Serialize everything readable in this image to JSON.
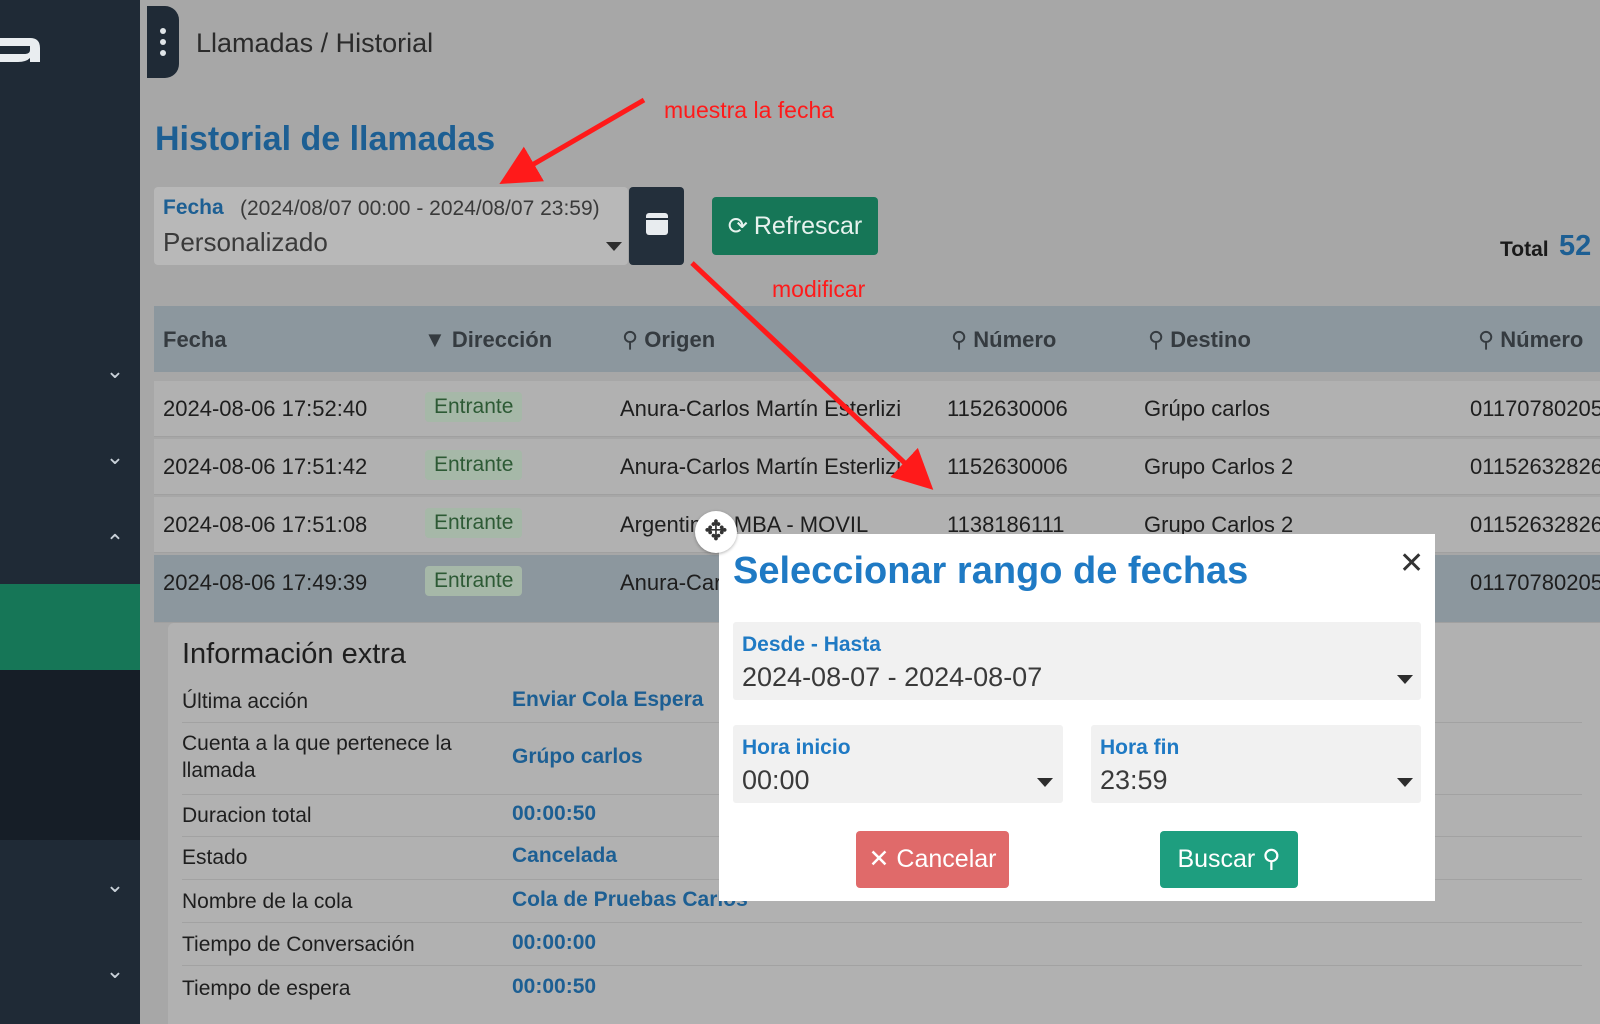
{
  "breadcrumb": "Llamadas / Historial",
  "page_title": "Historial de llamadas",
  "date_filter": {
    "label": "Fecha",
    "range": "(2024/08/07 00:00 - 2024/08/07 23:59)",
    "value": "Personalizado"
  },
  "refresh_label": "Refrescar",
  "total": {
    "label": "Total",
    "value": "52"
  },
  "table": {
    "headers": [
      "Fecha",
      "Dirección",
      "Origen",
      "Número",
      "Destino",
      "Número"
    ],
    "rows": [
      {
        "fecha": "2024-08-06 17:52:40",
        "direccion": "Entrante",
        "origen": "Anura-Carlos Martín Esterlizi",
        "numero": "1152630006",
        "destino": "Grúpo carlos",
        "numero2": "01170780205"
      },
      {
        "fecha": "2024-08-06 17:51:42",
        "direccion": "Entrante",
        "origen": "Anura-Carlos Martín Esterlizi",
        "numero": "1152630006",
        "destino": "Grupo Carlos 2",
        "numero2": "01152632826"
      },
      {
        "fecha": "2024-08-06 17:51:08",
        "direccion": "Entrante",
        "origen": "Argentina AMBA - MOVIL",
        "numero": "1138186111",
        "destino": "Grupo Carlos 2",
        "numero2": "01152632826"
      },
      {
        "fecha": "2024-08-06 17:49:39",
        "direccion": "Entrante",
        "origen": "Anura-Carlos Martín Esterlizi",
        "numero": "",
        "destino": "",
        "numero2": "01170780205"
      }
    ]
  },
  "extra_info": {
    "title": "Información extra",
    "items": [
      {
        "key": "Última acción",
        "value": "Enviar Cola Espera"
      },
      {
        "key": "Cuenta a la que pertenece la llamada",
        "value": "Grúpo carlos"
      },
      {
        "key": "Duracion total",
        "value": "00:00:50"
      },
      {
        "key": "Estado",
        "value": "Cancelada"
      },
      {
        "key": "Nombre de la cola",
        "value": "Cola de Pruebas Carlos"
      },
      {
        "key": "Tiempo de Conversación",
        "value": "00:00:00"
      },
      {
        "key": "Tiempo de espera",
        "value": "00:00:50"
      }
    ]
  },
  "modal": {
    "title": "Seleccionar rango de fechas",
    "range_label": "Desde - Hasta",
    "range_value": "2024-08-07 - 2024-08-07",
    "start_label": "Hora inicio",
    "start_value": "00:00",
    "end_label": "Hora fin",
    "end_value": "23:59",
    "cancel_label": "Cancelar",
    "search_label": "Buscar"
  },
  "annotations": {
    "show_date": "muestra la fecha",
    "modify": "modificar"
  },
  "colors": {
    "accent": "#1d5f93",
    "modal_accent": "#1f7ac4",
    "primary_green": "#167657",
    "search_green": "#1e9e7f",
    "cancel_red": "#e06a6a",
    "annotation_red": "#ff1a1a",
    "sidebar": "#1f2a36"
  }
}
